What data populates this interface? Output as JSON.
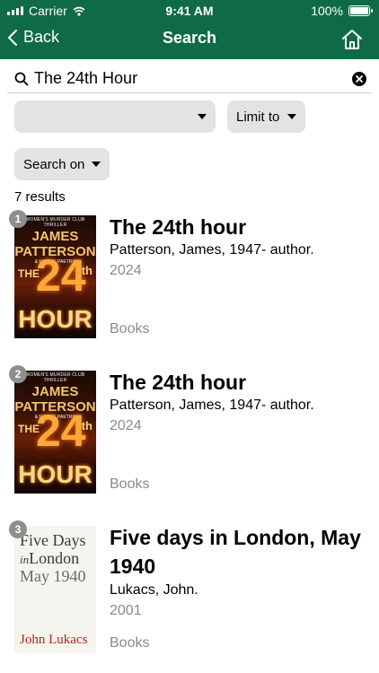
{
  "status_bar": {
    "carrier": "Carrier",
    "time": "9:41 AM",
    "battery": "100%"
  },
  "nav": {
    "back_label": "Back",
    "title": "Search"
  },
  "search": {
    "value": "The 24th Hour",
    "placeholder": ""
  },
  "filters": {
    "first_dropdown_value": "",
    "limit_label": "Limit to",
    "search_on_label": "Search on"
  },
  "results_count": "7 results",
  "results": [
    {
      "rank": "1",
      "title": "The 24th hour",
      "author": "Patterson, James, 1947- author.",
      "year": "2024",
      "format": "Books",
      "cover": {
        "tagline": "WOMEN'S MURDER CLUB THRILLER",
        "author_line1": "JAMES",
        "author_line2": "PATTERSON",
        "coauthor": "& MAXINE PAETRO",
        "the": "THE",
        "num": "24",
        "th": "th",
        "hour": "HOUR"
      }
    },
    {
      "rank": "2",
      "title": "The 24th hour",
      "author": "Patterson, James, 1947- author.",
      "year": "2024",
      "format": "Books",
      "cover": {
        "tagline": "WOMEN'S MURDER CLUB THRILLER",
        "author_line1": "JAMES",
        "author_line2": "PATTERSON",
        "coauthor": "& MAXINE PAETRO",
        "the": "THE",
        "num": "24",
        "th": "th",
        "hour": "HOUR"
      }
    },
    {
      "rank": "3",
      "title": "Five days in London, May 1940",
      "author": "Lukacs, John.",
      "year": "2001",
      "format": "Books",
      "cover": {
        "line1": "Five Days",
        "line2_prefix": "in",
        "line2": "London",
        "line3": "May 1940",
        "author": "John Lukacs"
      }
    }
  ],
  "colors": {
    "header": "#0e6b45",
    "dropdown_bg": "#e3e3e3",
    "muted_text": "#8a8a8a"
  },
  "icons": {
    "back": "chevron-left-icon",
    "home": "home-icon",
    "search": "search-icon",
    "clear": "clear-circle-icon",
    "caret": "caret-down-icon"
  }
}
